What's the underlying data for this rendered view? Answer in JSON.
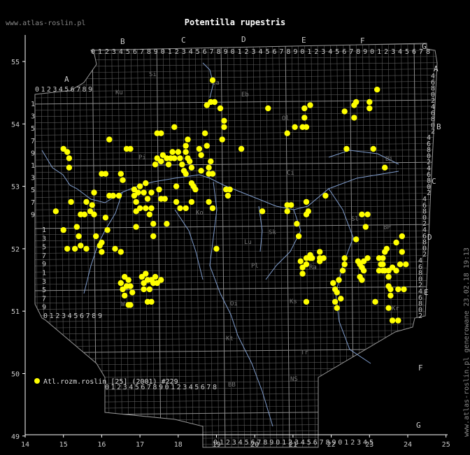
{
  "site": "www.atlas-roslin.pl",
  "title": "Potentilla rupestris",
  "generated": "www.atlas-roslin.pl generowane 23.02.18 19:13",
  "legend": {
    "label": "Atl.rozm.roslin [25] (2001) #229",
    "color": "#ffff00"
  },
  "axes": {
    "x_ticks": [
      "14",
      "15",
      "16",
      "17",
      "18",
      "19",
      "20",
      "21",
      "22",
      "23",
      "24",
      "25"
    ],
    "y_ticks": [
      "55",
      "54",
      "53",
      "52",
      "51",
      "50",
      "49"
    ]
  },
  "column_letters": [
    "A",
    "B",
    "C",
    "D",
    "E",
    "F",
    "G"
  ],
  "row_letters": [
    "A",
    "B",
    "C",
    "D",
    "E",
    "F",
    "G"
  ],
  "digit_sequences": {
    "a": "0123456789",
    "top": "0123456789012345678901234567890123456789012345678",
    "bottom1": "0123456789",
    "bottom2": "0123456789012345678",
    "bottom3": "01234567890123456789012345",
    "left": "1357913579",
    "right": "4680246802"
  },
  "region_codes": [
    "Si",
    "Ku",
    "Ea",
    "Eb",
    "Ol",
    "Pi",
    "Ci",
    "Bi",
    "Sk",
    "Lu",
    "Pl",
    "Ra",
    "Wr",
    "Oi",
    "Kt",
    "Tr",
    "NS",
    "Ks",
    "BB",
    "Sl",
    "BP",
    "Kr",
    "Ko"
  ],
  "chart_data": {
    "type": "scatter",
    "title": "Potentilla rupestris",
    "xlabel": "",
    "ylabel": "",
    "xlim": [
      14,
      25
    ],
    "ylim": [
      49,
      55.5
    ],
    "series": [
      {
        "name": "Atl.rozm.roslin [25] (2001) #229",
        "points": [
          [
            14.8,
            52.6
          ],
          [
            15.0,
            53.6
          ],
          [
            15.0,
            52.3
          ],
          [
            15.1,
            53.55
          ],
          [
            15.15,
            53.45
          ],
          [
            15.15,
            53.3
          ],
          [
            15.1,
            52.0
          ],
          [
            15.2,
            52.75
          ],
          [
            15.3,
            52.0
          ],
          [
            15.35,
            52.35
          ],
          [
            15.4,
            52.2
          ],
          [
            15.45,
            52.05
          ],
          [
            15.45,
            52.55
          ],
          [
            15.55,
            52.55
          ],
          [
            15.6,
            52.0
          ],
          [
            15.6,
            52.75
          ],
          [
            15.7,
            52.6
          ],
          [
            15.75,
            52.7
          ],
          [
            15.8,
            52.9
          ],
          [
            15.8,
            52.55
          ],
          [
            15.85,
            52.2
          ],
          [
            15.95,
            52.05
          ],
          [
            16.0,
            53.2
          ],
          [
            16.0,
            52.1
          ],
          [
            16.0,
            51.95
          ],
          [
            16.1,
            53.2
          ],
          [
            16.1,
            52.5
          ],
          [
            16.15,
            52.3
          ],
          [
            16.2,
            53.75
          ],
          [
            16.2,
            52.85
          ],
          [
            16.3,
            52.85
          ],
          [
            16.35,
            52.0
          ],
          [
            16.45,
            52.85
          ],
          [
            16.5,
            51.95
          ],
          [
            16.5,
            53.2
          ],
          [
            16.55,
            53.1
          ],
          [
            16.65,
            53.6
          ],
          [
            16.75,
            53.6
          ],
          [
            16.6,
            51.55
          ],
          [
            16.5,
            51.45
          ],
          [
            16.55,
            51.35
          ],
          [
            16.6,
            51.25
          ],
          [
            16.65,
            51.4
          ],
          [
            16.7,
            51.5
          ],
          [
            16.75,
            51.4
          ],
          [
            16.8,
            51.3
          ],
          [
            16.7,
            51.1
          ],
          [
            16.75,
            51.1
          ],
          [
            16.85,
            52.95
          ],
          [
            16.85,
            52.85
          ],
          [
            16.9,
            52.75
          ],
          [
            16.9,
            52.6
          ],
          [
            16.9,
            52.35
          ],
          [
            16.95,
            52.9
          ],
          [
            17.0,
            53.0
          ],
          [
            17.0,
            52.65
          ],
          [
            17.1,
            52.9
          ],
          [
            17.15,
            53.05
          ],
          [
            17.15,
            52.65
          ],
          [
            17.2,
            52.8
          ],
          [
            17.25,
            52.55
          ],
          [
            17.3,
            52.9
          ],
          [
            17.3,
            52.65
          ],
          [
            17.35,
            52.4
          ],
          [
            17.35,
            52.2
          ],
          [
            17.05,
            51.55
          ],
          [
            17.1,
            51.45
          ],
          [
            17.1,
            51.35
          ],
          [
            17.15,
            51.6
          ],
          [
            17.2,
            51.5
          ],
          [
            17.25,
            51.35
          ],
          [
            17.3,
            51.5
          ],
          [
            17.35,
            51.45
          ],
          [
            17.4,
            51.55
          ],
          [
            17.45,
            51.45
          ],
          [
            17.55,
            51.5
          ],
          [
            17.2,
            51.15
          ],
          [
            17.3,
            51.15
          ],
          [
            17.45,
            53.85
          ],
          [
            17.55,
            53.85
          ],
          [
            17.4,
            53.35
          ],
          [
            17.45,
            53.45
          ],
          [
            17.55,
            53.4
          ],
          [
            17.6,
            53.5
          ],
          [
            17.7,
            53.45
          ],
          [
            17.75,
            53.35
          ],
          [
            17.5,
            52.95
          ],
          [
            17.55,
            52.8
          ],
          [
            17.65,
            52.8
          ],
          [
            17.7,
            52.4
          ],
          [
            17.8,
            53.45
          ],
          [
            17.85,
            53.55
          ],
          [
            17.9,
            53.45
          ],
          [
            17.95,
            52.75
          ],
          [
            17.95,
            53.0
          ],
          [
            18.0,
            53.55
          ],
          [
            18.05,
            53.45
          ],
          [
            18.1,
            53.35
          ],
          [
            18.15,
            53.25
          ],
          [
            18.2,
            53.2
          ],
          [
            18.2,
            53.55
          ],
          [
            18.2,
            53.65
          ],
          [
            18.25,
            53.45
          ],
          [
            18.25,
            53.75
          ],
          [
            18.3,
            53.4
          ],
          [
            18.35,
            53.3
          ],
          [
            18.35,
            52.75
          ],
          [
            18.4,
            53.0
          ],
          [
            18.45,
            52.95
          ],
          [
            18.35,
            53.05
          ],
          [
            17.9,
            53.95
          ],
          [
            18.2,
            52.65
          ],
          [
            18.05,
            52.65
          ],
          [
            18.6,
            53.5
          ],
          [
            18.6,
            53.25
          ],
          [
            18.55,
            53.6
          ],
          [
            18.7,
            53.85
          ],
          [
            18.75,
            53.65
          ],
          [
            18.8,
            53.2
          ],
          [
            18.8,
            53.3
          ],
          [
            18.9,
            53.2
          ],
          [
            18.85,
            53.4
          ],
          [
            18.9,
            52.65
          ],
          [
            18.8,
            52.75
          ],
          [
            19.0,
            52.0
          ],
          [
            18.9,
            54.7
          ],
          [
            18.75,
            54.3
          ],
          [
            18.85,
            54.35
          ],
          [
            18.95,
            54.35
          ],
          [
            19.1,
            54.25
          ],
          [
            19.2,
            54.05
          ],
          [
            19.2,
            53.95
          ],
          [
            19.15,
            53.75
          ],
          [
            19.25,
            52.95
          ],
          [
            19.35,
            52.95
          ],
          [
            19.3,
            52.85
          ],
          [
            19.65,
            53.6
          ],
          [
            20.2,
            52.6
          ],
          [
            20.35,
            54.25
          ],
          [
            20.85,
            52.6
          ],
          [
            20.85,
            52.7
          ],
          [
            20.85,
            53.85
          ],
          [
            20.95,
            52.7
          ],
          [
            21.05,
            53.95
          ],
          [
            21.1,
            52.4
          ],
          [
            21.15,
            52.2
          ],
          [
            21.25,
            53.95
          ],
          [
            21.3,
            54.1
          ],
          [
            21.3,
            54.25
          ],
          [
            21.35,
            52.55
          ],
          [
            21.4,
            52.6
          ],
          [
            21.35,
            53.95
          ],
          [
            21.45,
            54.3
          ],
          [
            21.35,
            52.75
          ],
          [
            21.35,
            51.85
          ],
          [
            21.35,
            51.75
          ],
          [
            21.45,
            51.85
          ],
          [
            21.5,
            51.85
          ],
          [
            21.45,
            51.9
          ],
          [
            21.2,
            51.8
          ],
          [
            21.25,
            51.7
          ],
          [
            21.25,
            51.6
          ],
          [
            21.35,
            51.15
          ],
          [
            21.7,
            51.85
          ],
          [
            21.7,
            51.8
          ],
          [
            21.8,
            51.85
          ],
          [
            21.7,
            51.95
          ],
          [
            21.85,
            52.85
          ],
          [
            22.05,
            51.45
          ],
          [
            22.1,
            51.35
          ],
          [
            22.15,
            51.3
          ],
          [
            22.1,
            51.15
          ],
          [
            22.15,
            51.05
          ],
          [
            22.2,
            51.5
          ],
          [
            22.25,
            51.2
          ],
          [
            22.3,
            51.65
          ],
          [
            22.35,
            51.75
          ],
          [
            22.35,
            51.85
          ],
          [
            22.35,
            54.2
          ],
          [
            22.4,
            53.6
          ],
          [
            22.6,
            54.1
          ],
          [
            22.6,
            54.3
          ],
          [
            22.65,
            54.35
          ],
          [
            22.65,
            52.15
          ],
          [
            22.7,
            51.8
          ],
          [
            22.75,
            51.75
          ],
          [
            22.75,
            51.55
          ],
          [
            22.8,
            51.7
          ],
          [
            22.8,
            51.5
          ],
          [
            22.85,
            51.8
          ],
          [
            22.85,
            51.65
          ],
          [
            22.8,
            52.55
          ],
          [
            22.9,
            52.35
          ],
          [
            22.95,
            51.85
          ],
          [
            22.95,
            52.55
          ],
          [
            23.0,
            54.35
          ],
          [
            23.0,
            54.25
          ],
          [
            23.1,
            53.6
          ],
          [
            23.2,
            54.55
          ],
          [
            23.25,
            51.85
          ],
          [
            23.25,
            51.65
          ],
          [
            23.3,
            51.75
          ],
          [
            23.35,
            51.85
          ],
          [
            23.35,
            51.75
          ],
          [
            23.35,
            51.65
          ],
          [
            23.4,
            51.95
          ],
          [
            23.4,
            51.65
          ],
          [
            23.45,
            52.0
          ],
          [
            23.5,
            51.65
          ],
          [
            23.5,
            51.4
          ],
          [
            23.5,
            51.55
          ],
          [
            23.55,
            51.25
          ],
          [
            23.55,
            51.35
          ],
          [
            23.4,
            53.3
          ],
          [
            23.6,
            51.7
          ],
          [
            23.6,
            50.85
          ],
          [
            23.7,
            52.1
          ],
          [
            23.7,
            51.65
          ],
          [
            23.75,
            51.35
          ],
          [
            23.75,
            50.85
          ],
          [
            23.8,
            51.75
          ],
          [
            23.85,
            51.95
          ],
          [
            23.85,
            52.2
          ],
          [
            23.9,
            51.35
          ],
          [
            23.95,
            51.75
          ],
          [
            23.5,
            51.05
          ],
          [
            23.15,
            51.15
          ]
        ]
      }
    ]
  }
}
